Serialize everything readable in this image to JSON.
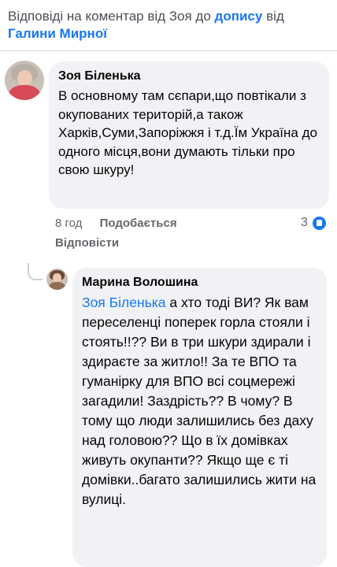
{
  "header": {
    "prefix": "Відповіді на коментар від Зоя до ",
    "post_link": "допису",
    "middle": " від ",
    "author_link": "Галини Мирної"
  },
  "comments": [
    {
      "author": "Зоя Біленька",
      "text": "В основному там сєпари,що повтікали з окупованих територій,а також Харків,Суми,Запоріжжя і т.д.Їм Україна до одного місця,вони думають тільки про свою шкуру!",
      "time": "8 год",
      "like_label": "Подобається",
      "reply_label": "Відповісти",
      "reaction_count": "3",
      "reaction_icon": "like-icon"
    },
    {
      "author": "Марина Волошина",
      "mention": "Зоя Біленька",
      "text": " а хто тоді ВИ? Як вам переселенці поперек горла стояли і стоять!!?? Ви в три шкури здирали і здираєте за житло!! За те ВПО та гуманірку для ВПО всі соцмережі загадили! Заздрість?? В чому? В тому що люди залишились без даху над головою?? Що в їх домівках живуть окупанти?? Якщо ще є ті домівки..багато залишились жити на вулиці."
    }
  ],
  "colors": {
    "link": "#1877f2",
    "bubble": "#f0f2f5",
    "meta_text": "#65676b"
  }
}
